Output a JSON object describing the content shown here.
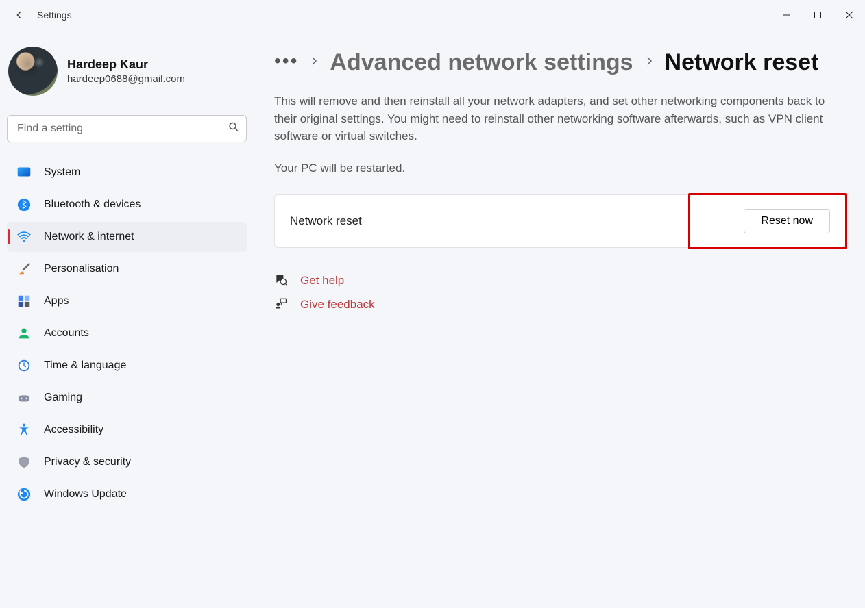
{
  "app": {
    "title": "Settings"
  },
  "profile": {
    "name": "Hardeep Kaur",
    "email": "hardeep0688@gmail.com"
  },
  "search": {
    "placeholder": "Find a setting"
  },
  "sidebar": {
    "items": [
      {
        "label": "System"
      },
      {
        "label": "Bluetooth & devices"
      },
      {
        "label": "Network & internet"
      },
      {
        "label": "Personalisation"
      },
      {
        "label": "Apps"
      },
      {
        "label": "Accounts"
      },
      {
        "label": "Time & language"
      },
      {
        "label": "Gaming"
      },
      {
        "label": "Accessibility"
      },
      {
        "label": "Privacy & security"
      },
      {
        "label": "Windows Update"
      }
    ],
    "activeIndex": 2
  },
  "breadcrumb": {
    "link": "Advanced network settings",
    "current": "Network reset"
  },
  "content": {
    "description": "This will remove and then reinstall all your network adapters, and set other networking components back to their original settings. You might need to reinstall other networking software afterwards, such as VPN client software or virtual switches.",
    "restart_note": "Your PC will be restarted.",
    "card_title": "Network reset",
    "reset_button": "Reset now",
    "help_link": "Get help",
    "feedback_link": "Give feedback"
  }
}
